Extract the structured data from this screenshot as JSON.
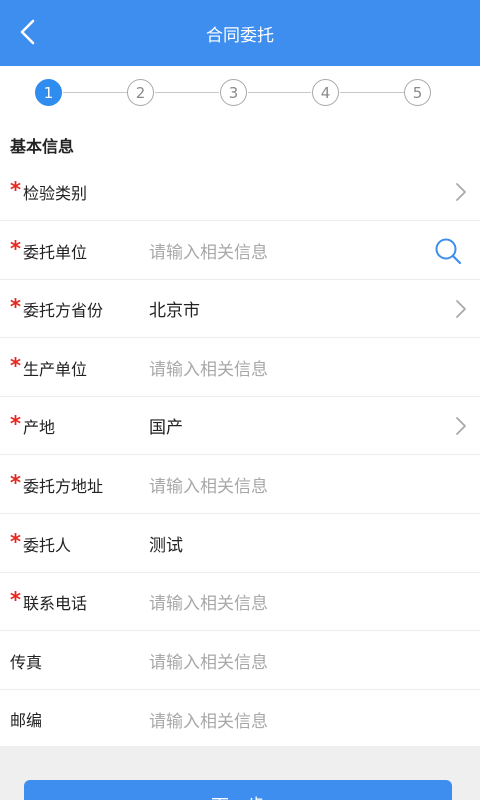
{
  "header": {
    "title": "合同委托"
  },
  "steps": [
    "1",
    "2",
    "3",
    "4",
    "5"
  ],
  "form": {
    "section_title": "基本信息",
    "rows": [
      {
        "label": "检验类别",
        "required": true,
        "value": "",
        "placeholder": "",
        "accessory": "chevron"
      },
      {
        "label": "委托单位",
        "required": true,
        "value": "",
        "placeholder": "请输入相关信息",
        "accessory": "search"
      },
      {
        "label": "委托方省份",
        "required": true,
        "value": "北京市",
        "placeholder": "",
        "accessory": "chevron"
      },
      {
        "label": "生产单位",
        "required": true,
        "value": "",
        "placeholder": "请输入相关信息",
        "accessory": ""
      },
      {
        "label": "产地",
        "required": true,
        "value": "国产",
        "placeholder": "",
        "accessory": "chevron"
      },
      {
        "label": "委托方地址",
        "required": true,
        "value": "",
        "placeholder": "请输入相关信息",
        "accessory": ""
      },
      {
        "label": "委托人",
        "required": true,
        "value": "测试",
        "placeholder": "",
        "accessory": ""
      },
      {
        "label": "联系电话",
        "required": true,
        "value": "",
        "placeholder": "请输入相关信息",
        "accessory": ""
      },
      {
        "label": "传真",
        "required": false,
        "value": "",
        "placeholder": "请输入相关信息",
        "accessory": ""
      },
      {
        "label": "邮编",
        "required": false,
        "value": "",
        "placeholder": "请输入相关信息",
        "accessory": ""
      }
    ]
  },
  "footer": {
    "next_label": "下一步"
  },
  "colors": {
    "primary": "#3e8ef0",
    "required": "#e8261f",
    "placeholder": "#a8a8a8"
  }
}
